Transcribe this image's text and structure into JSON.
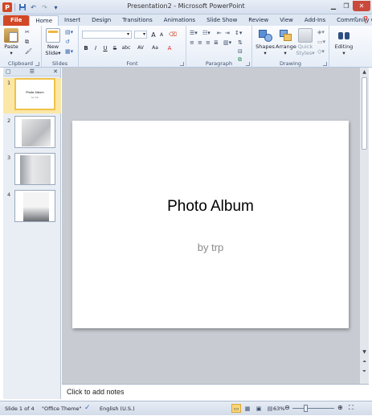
{
  "window": {
    "title": "Presentation2 - Microsoft PowerPoint",
    "app_icon": "P",
    "controls": [
      "minimize-icon",
      "maximize-icon",
      "close-icon"
    ]
  },
  "qat": {
    "icons": [
      "save-icon",
      "undo-icon",
      "redo-icon",
      "customize-icon"
    ]
  },
  "tabs": [
    {
      "label": "File"
    },
    {
      "label": "Home"
    },
    {
      "label": "Insert"
    },
    {
      "label": "Design"
    },
    {
      "label": "Transitions"
    },
    {
      "label": "Animations"
    },
    {
      "label": "Slide Show"
    },
    {
      "label": "Review"
    },
    {
      "label": "View"
    },
    {
      "label": "Add-Ins"
    },
    {
      "label": "Community Clips"
    }
  ],
  "ribbon": {
    "groups": {
      "clipboard": "Clipboard",
      "slides": "Slides",
      "font": "Font",
      "paragraph": "Paragraph",
      "drawing": "Drawing",
      "editing": ""
    },
    "buttons": {
      "paste": "Paste",
      "new_slide_1": "New",
      "new_slide_2": "Slide",
      "shapes": "Shapes",
      "arrange": "Arrange",
      "quick_styles_1": "Quick",
      "quick_styles_2": "Styles",
      "editing": "Editing"
    },
    "font_format": {
      "bold": "B",
      "italic": "I",
      "underline": "U",
      "strike": "S",
      "shadow": "abc",
      "spacing": "AV",
      "case": "Aa",
      "grow": "A",
      "shrink": "A"
    }
  },
  "slide_pane": {
    "thumbnails": [
      {
        "num": "1",
        "title": "Photo Album",
        "sub": "by trp",
        "selected": true
      },
      {
        "num": "2"
      },
      {
        "num": "3"
      },
      {
        "num": "4"
      }
    ]
  },
  "slide": {
    "title": "Photo Album",
    "subtitle": "by trp"
  },
  "notes": {
    "placeholder": "Click to add notes"
  },
  "status": {
    "slide_info": "Slide 1 of 4",
    "theme": "\"Office Theme\"",
    "language": "English (U.S.)",
    "zoom": "63%",
    "zoom_fraction": 0.63
  }
}
